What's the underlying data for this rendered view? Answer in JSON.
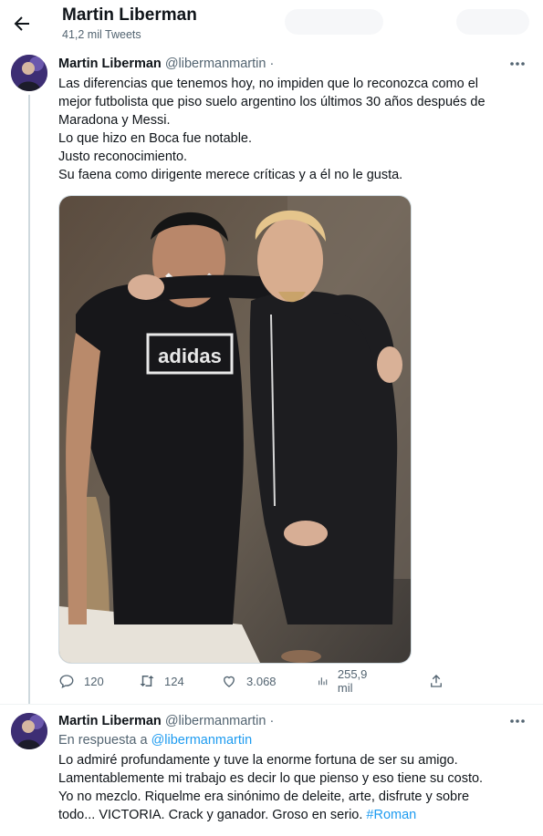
{
  "header": {
    "title": "Martin Liberman",
    "tweet_count": "41,2 mil Tweets"
  },
  "tweet": {
    "name": "Martin Liberman",
    "handle": "@libermanmartin ·",
    "text": "Las diferencias que tenemos hoy, no impiden que lo reconozca como el\nmejor futbolista que piso suelo argentino los últimos 30 años después de\nMaradona y Messi.\nLo que hizo en Boca fue notable.\nJusto reconocimiento.\nSu faena como dirigente merece críticas y a él no le gusta.",
    "photo_shirt_text": "adidas",
    "actions": {
      "replies": "120",
      "retweets": "124",
      "likes": "3.068",
      "views": "255,9 mil"
    }
  },
  "reply": {
    "name": "Martin Liberman",
    "handle": "@libermanmartin ·",
    "reply_prefix": "En respuesta a ",
    "reply_handle": "@libermanmartin",
    "text": "Lo admiré profundamente y tuve la enorme fortuna de ser su amigo.\nLamentablemente mi trabajo es decir lo que pienso y eso tiene su costo.\nYo no mezclo. Riquelme era sinónimo de deleite, arte, disfrute y sobre\ntodo... VICTORIA. Crack y ganador. Groso en serio. ",
    "hashtag": "#Roman"
  },
  "colors": {
    "accent": "#1d9bf0",
    "secondary_text": "#536471",
    "divider": "#eff3f4"
  },
  "icons": [
    "back-arrow-icon",
    "more-icon",
    "reply-icon",
    "retweet-icon",
    "like-icon",
    "views-icon",
    "share-icon"
  ]
}
